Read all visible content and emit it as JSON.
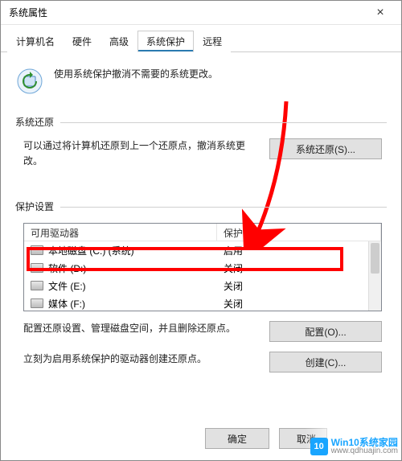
{
  "titlebar": {
    "title": "系统属性",
    "close_label": "×"
  },
  "tabs": [
    {
      "label": "计算机名"
    },
    {
      "label": "硬件"
    },
    {
      "label": "高级"
    },
    {
      "label": "系统保护",
      "active": true
    },
    {
      "label": "远程"
    }
  ],
  "info": {
    "text": "使用系统保护撤消不需要的系统更改。"
  },
  "restore": {
    "group_label": "系统还原",
    "text": "可以通过将计算机还原到上一个还原点，撤消系统更改。",
    "button": "系统还原(S)..."
  },
  "protect": {
    "group_label": "保护设置",
    "columns": {
      "drive": "可用驱动器",
      "status": "保护"
    },
    "rows": [
      {
        "name": "本地磁盘 (C:) (系统)",
        "status": "启用",
        "icon": "drive"
      },
      {
        "name": "软件 (D:)",
        "status": "关闭",
        "icon": "drive"
      },
      {
        "name": "文件 (E:)",
        "status": "关闭",
        "icon": "drive"
      },
      {
        "name": "媒体 (F:)",
        "status": "关闭",
        "icon": "drive"
      }
    ],
    "configure_text": "配置还原设置、管理磁盘空间，并且删除还原点。",
    "configure_btn": "配置(O)...",
    "create_text": "立刻为启用系统保护的驱动器创建还原点。",
    "create_btn": "创建(C)..."
  },
  "footer": {
    "ok": "确定",
    "cancel": "取消"
  },
  "watermark": {
    "badge": "10",
    "line1": "Win10系统家园",
    "line2": "www.qdhuajin.com"
  }
}
